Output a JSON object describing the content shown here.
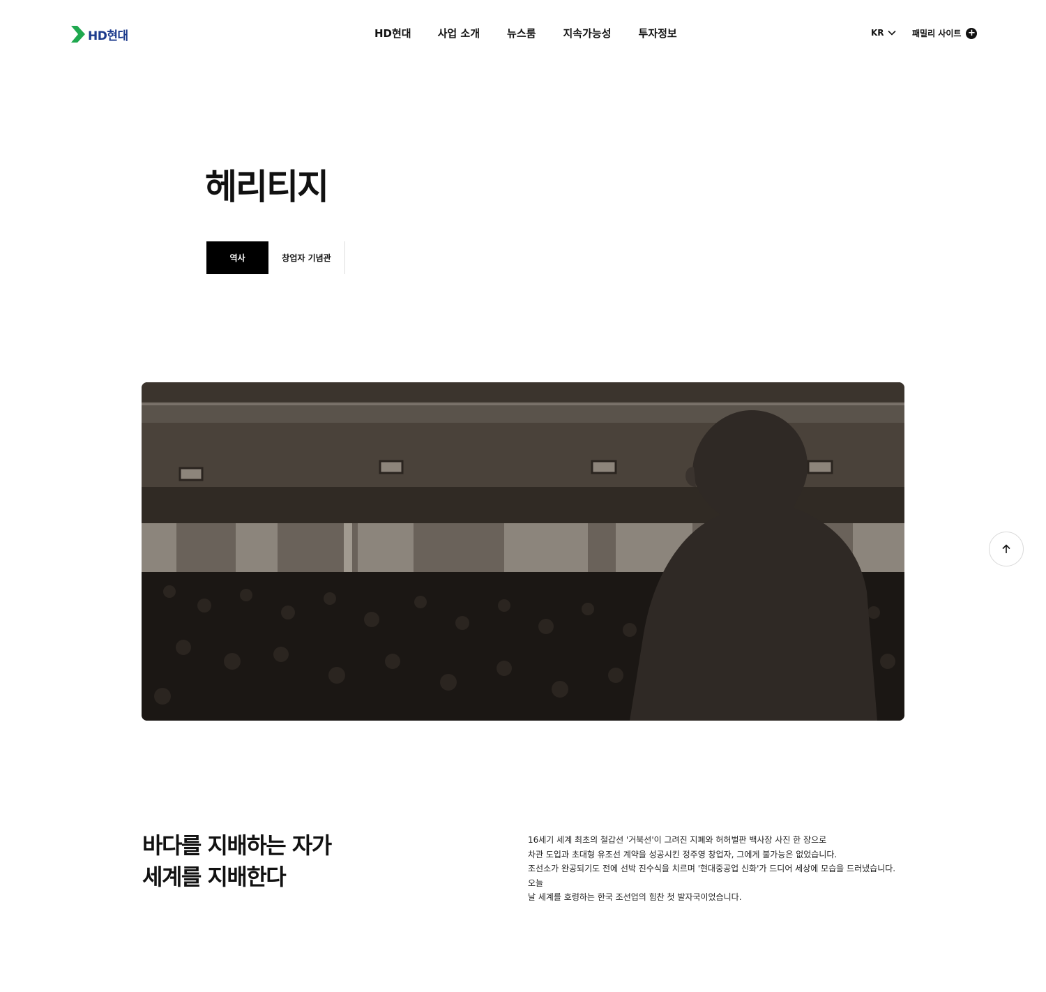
{
  "header": {
    "logo_text": "HD현대",
    "nav": [
      "HD현대",
      "사업 소개",
      "뉴스룸",
      "지속가능성",
      "투자정보"
    ],
    "lang": "KR",
    "family_site": "패밀리 사이트"
  },
  "page": {
    "title": "헤리티지",
    "tabs": [
      "역사",
      "창업자 기념관"
    ]
  },
  "intro": {
    "headline": [
      "바다를 지배하는 자가",
      "세계를 지배한다"
    ],
    "body": [
      "16세기 세계 최초의 철갑선 '거북선'이 그려진 지폐와 허허벌판 백사장 사진 한 장으로",
      "차관 도입과 초대형 유조선 계약을 성공시킨 정주영 창업자, 그에게 불가능은 없었습니다.",
      "조선소가 완공되기도 전에 선박 진수식을 치르며 '현대중공업 신화'가 드디어 세상에 모습을 드러냈습니다. 오늘",
      "날 세계를 호령하는 한국 조선업의 힘찬 첫 발자국이었습니다."
    ]
  },
  "colors": {
    "logo_green": "#1fa84f",
    "logo_blue": "#1b3a8c",
    "active_tab": "#000000"
  },
  "icons": {
    "lang_toggle": "chevron-down-icon",
    "family_site": "plus-circle-icon",
    "scroll_top": "arrow-up-icon"
  }
}
